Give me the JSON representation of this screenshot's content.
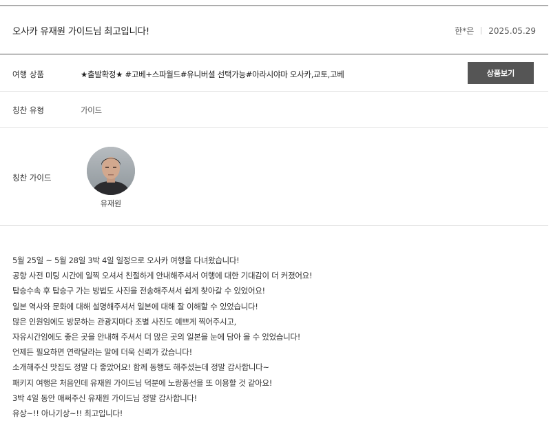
{
  "review": {
    "title": "오사카 유재원 가이드님 최고입니다!",
    "author": "한*은",
    "date": "2025.05.29"
  },
  "product": {
    "label": "여행 상품",
    "name": "★출발확정★ #고베+스파월드#유니버셜 선택가능#아라시야마 오사카,교토,고베",
    "button_label": "상품보기"
  },
  "praise_type": {
    "label": "칭찬 유형",
    "value": "가이드"
  },
  "praise_guide": {
    "label": "칭찬 가이드",
    "name": "유재원"
  },
  "body_lines": [
    "5월 25일 ~ 5월 28일 3박 4일 일정으로 오사카 여행을 다녀왔습니다!",
    "공항 사전 미팅 시간에 일찍 오셔서 친절하게 안내해주셔서 여행에 대한 기대감이 더 커졌어요!",
    "탑승수속 후 탑승구 가는 방법도 사진을 전송해주셔서 쉽게 찾아갈 수 있었어요!",
    "일본 역사와 문화에 대해 설명해주셔서 일본에 대해 잘 이해할 수 있었습니다!",
    "많은 인원임에도 방문하는 관광지마다 조별 사진도 예쁘게 찍어주시고,",
    "자유시간임에도 좋은 곳을 안내해 주셔서 더 많은 곳의 일본을 눈에 담아 올 수 있었습니다!",
    "언제든 필요하면 연락달라는 말에 더욱 신뢰가 갔습니다!",
    "소개해주신 맛집도 정말 다 좋았어요! 함께 동행도 해주셨는데 정말 감사합니다~",
    "패키지 여행은 처음인데 유재원 가이드님 덕분에 노랑풍선을 또 이용할 것 같아요!",
    "3박 4일 동안 애써주신 유재원 가이드님 정말 감사합니다!",
    "유상~!! 아나기상~!! 최고입니다!"
  ]
}
